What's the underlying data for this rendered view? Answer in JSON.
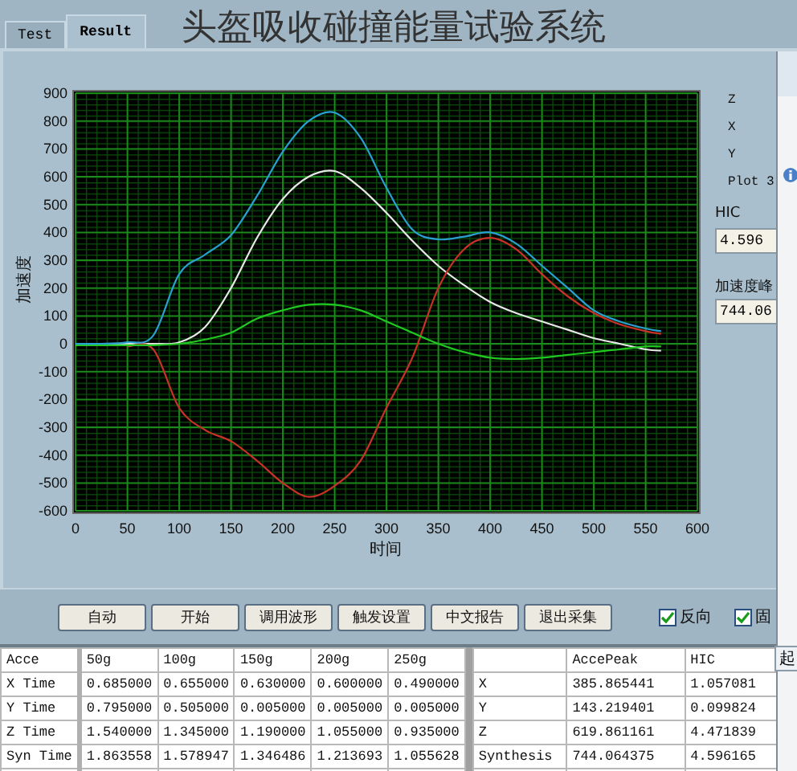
{
  "tabs": [
    {
      "label": "Test",
      "selected": false
    },
    {
      "label": "Result",
      "selected": true
    }
  ],
  "title": "头盔吸收碰撞能量试验系统",
  "chart_data": {
    "type": "line",
    "xlabel": "时间",
    "ylabel": "加速度",
    "xlim": [
      0,
      600
    ],
    "ylim": [
      -600,
      900
    ],
    "grid": true,
    "xticks": [
      0,
      50,
      100,
      150,
      200,
      250,
      300,
      350,
      400,
      450,
      500,
      550,
      600
    ],
    "yticks": [
      -600,
      -500,
      -400,
      -300,
      -200,
      -100,
      0,
      100,
      200,
      300,
      400,
      500,
      600,
      700,
      800,
      900
    ],
    "x": [
      0,
      25,
      50,
      75,
      100,
      125,
      150,
      175,
      200,
      225,
      250,
      275,
      300,
      325,
      350,
      375,
      400,
      425,
      450,
      475,
      500,
      525,
      550,
      565
    ],
    "series": [
      {
        "name": "Z",
        "color": "#e8e8e8",
        "values": [
          0,
          0,
          0,
          0,
          5,
          60,
          200,
          380,
          520,
          600,
          620,
          560,
          470,
          370,
          280,
          210,
          150,
          110,
          80,
          50,
          20,
          0,
          -20,
          -25
        ]
      },
      {
        "name": "X",
        "color": "#c83228",
        "values": [
          null,
          null,
          -10,
          -20,
          -230,
          -310,
          -350,
          -420,
          -500,
          -550,
          -510,
          -420,
          -230,
          -50,
          200,
          340,
          380,
          340,
          250,
          170,
          110,
          70,
          45,
          35
        ]
      },
      {
        "name": "Y",
        "color": "#22c822",
        "values": [
          -5,
          -5,
          -5,
          -5,
          0,
          15,
          40,
          90,
          120,
          140,
          140,
          120,
          80,
          40,
          0,
          -30,
          -50,
          -55,
          -50,
          -40,
          -30,
          -20,
          -10,
          -10
        ]
      },
      {
        "name": "Plot 3",
        "color": "#2aa0d0",
        "values": [
          0,
          0,
          5,
          30,
          250,
          320,
          390,
          530,
          690,
          800,
          830,
          740,
          560,
          410,
          375,
          385,
          400,
          360,
          280,
          200,
          120,
          80,
          55,
          45
        ]
      }
    ]
  },
  "readouts": [
    {
      "label": "HIC",
      "value": "4.596"
    },
    {
      "label": "加速度峰",
      "value": "744.06"
    }
  ],
  "buttons": [
    "自动",
    "开始",
    "调用波形",
    "触发设置",
    "中文报告",
    "退出采集"
  ],
  "checkboxes": [
    {
      "label": "反向",
      "checked": true
    },
    {
      "label": "固",
      "checked": true
    }
  ],
  "time_table": {
    "columns": [
      "Acce",
      "50g",
      "100g",
      "150g",
      "200g",
      "250g"
    ],
    "rows": [
      [
        "X Time",
        "0.685000",
        "0.655000",
        "0.630000",
        "0.600000",
        "0.490000"
      ],
      [
        "Y Time",
        "0.795000",
        "0.505000",
        "0.005000",
        "0.005000",
        "0.005000"
      ],
      [
        "Z Time",
        "1.540000",
        "1.345000",
        "1.190000",
        "1.055000",
        "0.935000"
      ],
      [
        "Syn Time",
        "1.863558",
        "1.578947",
        "1.346486",
        "1.213693",
        "1.055628"
      ]
    ]
  },
  "peak_table": {
    "columns": [
      "",
      "AccePeak",
      "HIC"
    ],
    "rows": [
      [
        "X",
        "385.865441",
        "1.057081"
      ],
      [
        "Y",
        "143.219401",
        "0.099824"
      ],
      [
        "Z",
        "619.861161",
        "4.471839"
      ],
      [
        "Synthesis",
        "744.064375",
        "4.596165"
      ]
    ]
  },
  "popup": {
    "button": "起"
  }
}
